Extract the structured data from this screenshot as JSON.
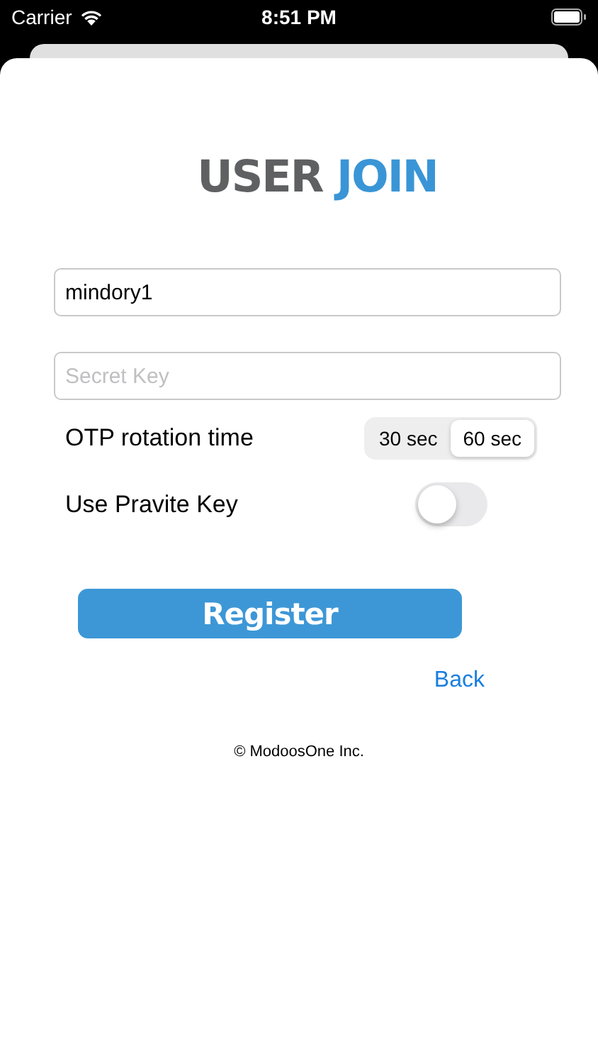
{
  "status_bar": {
    "carrier": "Carrier",
    "time": "8:51 PM"
  },
  "logo": {
    "first": "USER",
    "second": "JOIN"
  },
  "username_field": {
    "value": "mindory1"
  },
  "secret_key_field": {
    "placeholder": "Secret Key"
  },
  "otp_rotation": {
    "label": "OTP rotation time",
    "options": [
      {
        "label": "30 sec",
        "selected": false
      },
      {
        "label": "60 sec",
        "selected": true
      }
    ]
  },
  "private_key": {
    "label": "Use Pravite Key",
    "on": false
  },
  "register_button": "Register",
  "back_link": "Back",
  "copyright": "© ModoosOne Inc."
}
